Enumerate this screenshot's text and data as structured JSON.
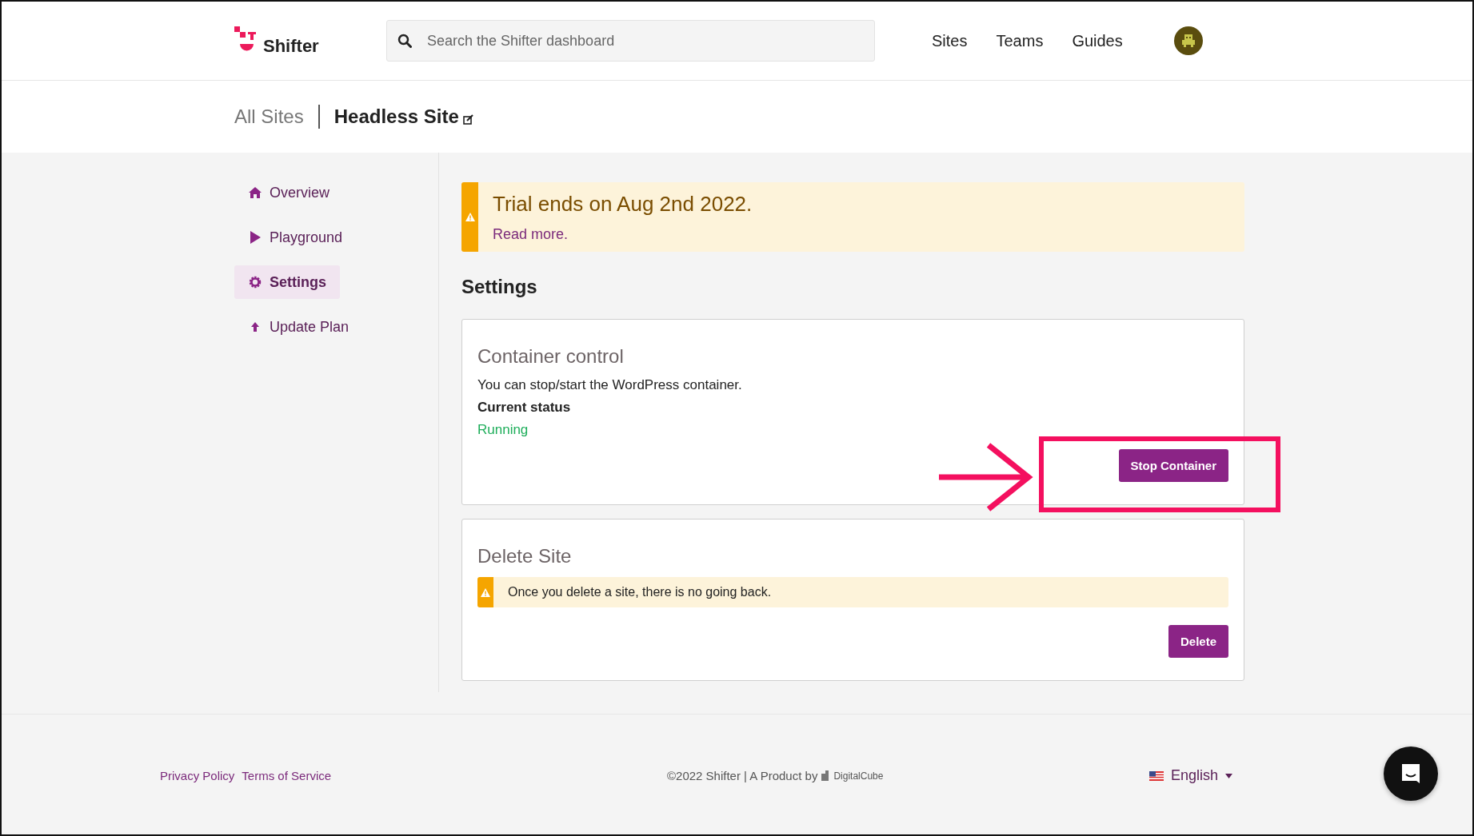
{
  "header": {
    "logo_text": "Shifter",
    "search": {
      "placeholder": "Search the Shifter dashboard"
    },
    "nav": [
      "Sites",
      "Teams",
      "Guides"
    ]
  },
  "breadcrumb": {
    "parent": "All Sites",
    "current": "Headless Site"
  },
  "sidebar": {
    "items": [
      {
        "label": "Overview",
        "selected": false
      },
      {
        "label": "Playground",
        "selected": false
      },
      {
        "label": "Settings",
        "selected": true
      },
      {
        "label": "Update Plan",
        "selected": false
      }
    ]
  },
  "trial_banner": {
    "title": "Trial ends on Aug 2nd 2022.",
    "link": "Read more."
  },
  "section_title": "Settings",
  "cards": [
    {
      "kind": "status",
      "title": "Container control",
      "description": "You can stop/start the WordPress container.",
      "status_label": "Current status",
      "status": "Running",
      "button": "Stop Container",
      "highlighted": true
    },
    {
      "kind": "warning",
      "title": "Delete Site",
      "warning": "Once you delete a site, there is no going back.",
      "button": "Delete",
      "highlighted": false
    }
  ],
  "footer": {
    "links": [
      "Privacy Policy",
      "Terms of Service"
    ],
    "copyright": "©2022 Shifter | A Product by",
    "brand": "DigitalCube",
    "language": "English"
  }
}
